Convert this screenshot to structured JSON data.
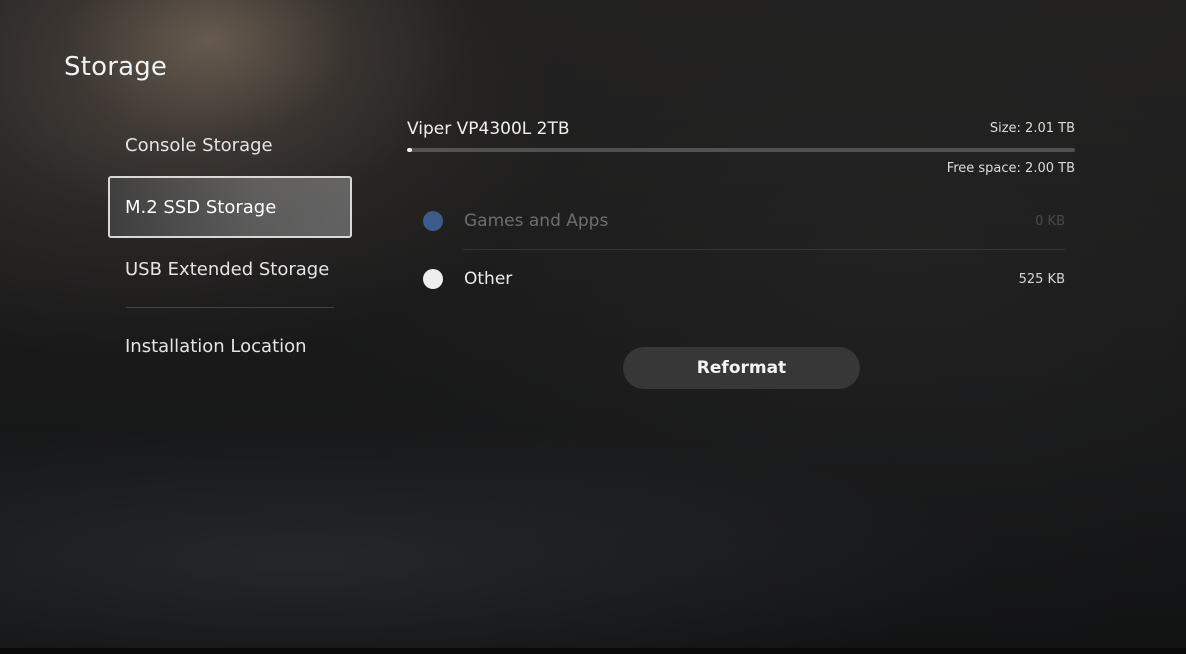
{
  "page": {
    "title": "Storage"
  },
  "sidebar": {
    "items": [
      {
        "label": "Console Storage",
        "selected": false
      },
      {
        "label": "M.2 SSD Storage",
        "selected": true
      },
      {
        "label": "USB Extended Storage",
        "selected": false
      },
      {
        "label": "Installation Location",
        "selected": false
      }
    ]
  },
  "drive": {
    "name": "Viper VP4300L 2TB",
    "size_text": "Size: 2.01 TB",
    "free_text": "Free space: 2.00 TB",
    "used_fraction": 0.005
  },
  "categories": [
    {
      "label": "Games and Apps",
      "value": "0 KB",
      "color": "#3d5a8c",
      "icon": "blue-dot-icon",
      "dimmed": true
    },
    {
      "label": "Other",
      "value": "525 KB",
      "color": "#eeeeee",
      "icon": "white-dot-icon",
      "dimmed": false
    }
  ],
  "actions": {
    "reformat_label": "Reformat"
  }
}
